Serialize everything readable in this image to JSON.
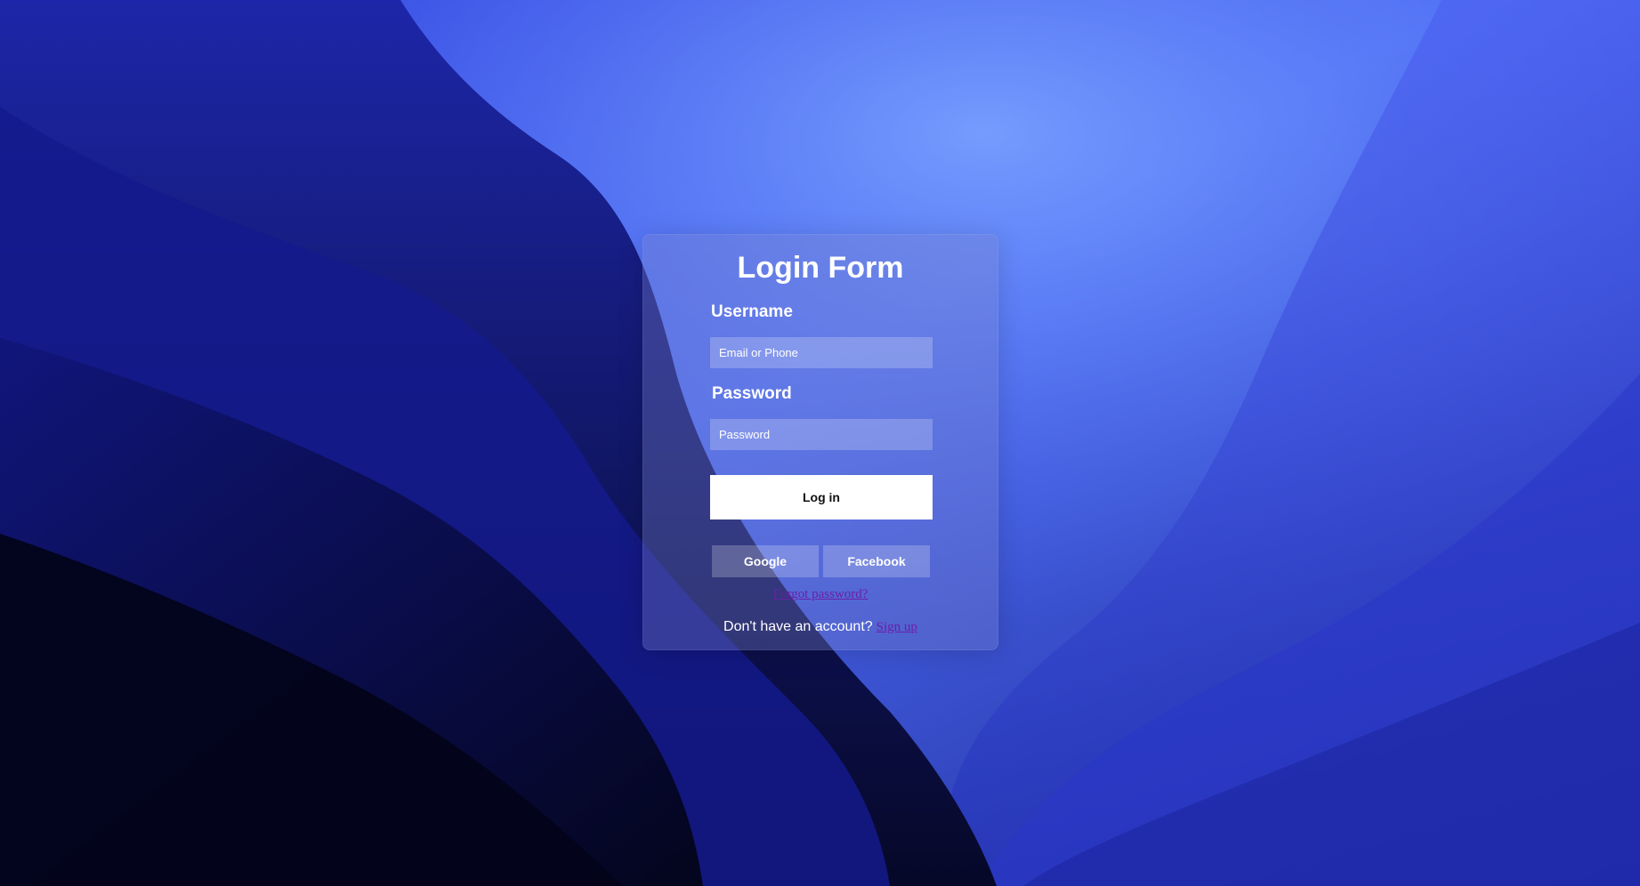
{
  "form": {
    "title": "Login Form",
    "username_label": "Username",
    "username_placeholder": "Email or Phone",
    "password_label": "Password",
    "password_placeholder": "Password",
    "login_label": "Log in",
    "google_label": "Google",
    "facebook_label": "Facebook",
    "forgot_label": "Forgot password?",
    "signup_prompt": "Don't have an account?",
    "signup_link": "Sign up"
  },
  "colors": {
    "card_bg": "rgba(120,130,200,0.35)",
    "link": "#6b1fa8",
    "button_bg": "#ffffff",
    "background_light": "#5b86ff",
    "background_dark": "#05061a"
  }
}
